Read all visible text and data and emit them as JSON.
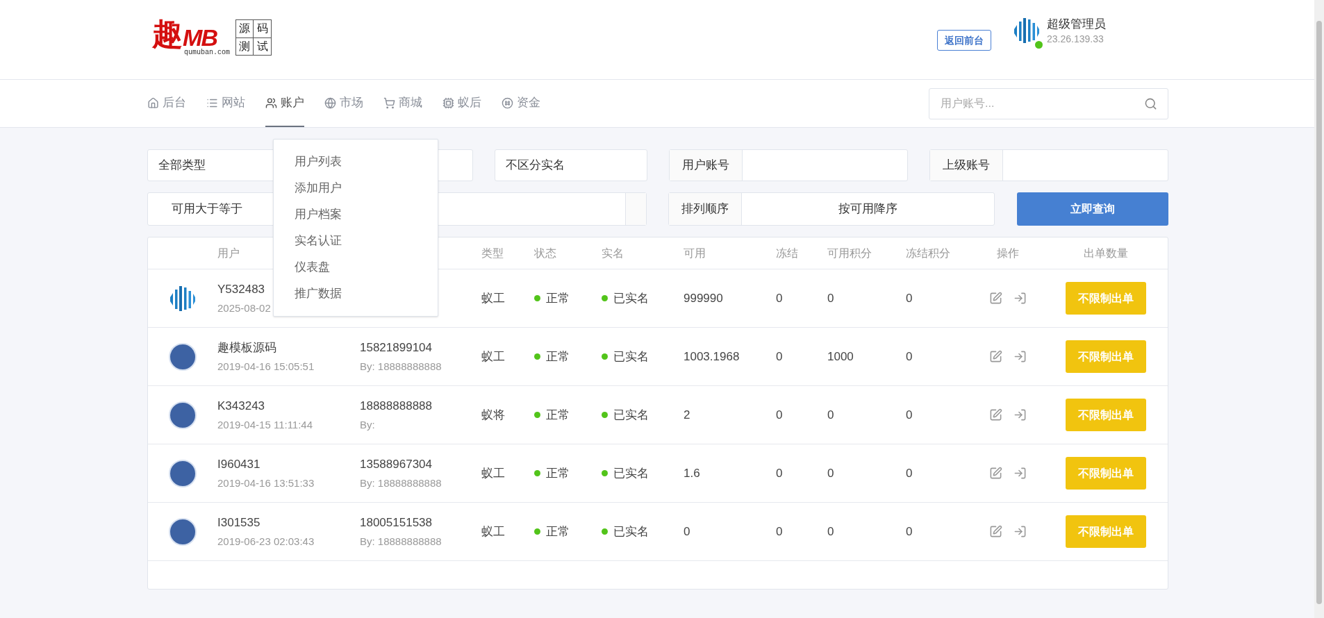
{
  "header": {
    "logo": {
      "mark": "趣",
      "letters": "MB",
      "domain": "qumuban.com",
      "tiles": [
        "源",
        "码",
        "测",
        "试"
      ]
    },
    "front_button": "返回前台",
    "admin": {
      "name": "超级管理员",
      "ip": "23.26.139.33",
      "online": true
    }
  },
  "nav": {
    "items": [
      {
        "label": "后台",
        "selected": false
      },
      {
        "label": "网站",
        "selected": false
      },
      {
        "label": "账户",
        "selected": true
      },
      {
        "label": "市场",
        "selected": false
      },
      {
        "label": "商城",
        "selected": false
      },
      {
        "label": "蚁后",
        "selected": false
      },
      {
        "label": "资金",
        "selected": false
      }
    ],
    "search": {
      "placeholder": "用户账号..."
    }
  },
  "menu": {
    "items": [
      "用户列表",
      "添加用户",
      "用户档案",
      "实名认证",
      "仪表盘",
      "推广数据"
    ]
  },
  "filters": {
    "type_select": "全部类型",
    "realname_select": "不区分实名",
    "account": {
      "label": "用户账号"
    },
    "parent_account": {
      "label": "上级账号"
    },
    "min_available": {
      "label": "可用大于等于"
    },
    "sort": {
      "label": "排列顺序",
      "value": "按可用降序"
    },
    "submit": "立即查询"
  },
  "table": {
    "columns": {
      "user": "用户",
      "type": "类型",
      "status": "状态",
      "realname": "实名",
      "available": "可用",
      "frozen": "冻结",
      "points": "可用积分",
      "frozen_points": "冻结积分",
      "actions": "操作",
      "orders": "出单数量"
    },
    "rows": [
      {
        "avatar_photo": false,
        "name": "Y532483",
        "date": "2025-08-02",
        "type": "蚁工",
        "status": "正常",
        "realname": "已实名",
        "available": "999990",
        "frozen": "0",
        "points": "0",
        "frozen_points": "0",
        "orders": "不限制出单"
      },
      {
        "avatar_photo": true,
        "name": "趣模板源码",
        "date": "2019-04-16 15:05:51",
        "account": "15821899104",
        "by": "By: 18888888888",
        "type": "蚁工",
        "status": "正常",
        "realname": "已实名",
        "available": "1003.1968",
        "frozen": "0",
        "points": "1000",
        "frozen_points": "0",
        "orders": "不限制出单"
      },
      {
        "avatar_photo": true,
        "name": "K343243",
        "date": "2019-04-15 11:11:44",
        "account": "18888888888",
        "by": "By:",
        "type": "蚁将",
        "status": "正常",
        "realname": "已实名",
        "available": "2",
        "frozen": "0",
        "points": "0",
        "frozen_points": "0",
        "orders": "不限制出单"
      },
      {
        "avatar_photo": true,
        "name": "I960431",
        "date": "2019-04-16 13:51:33",
        "account": "13588967304",
        "by": "By: 18888888888",
        "type": "蚁工",
        "status": "正常",
        "realname": "已实名",
        "available": "1.6",
        "frozen": "0",
        "points": "0",
        "frozen_points": "0",
        "orders": "不限制出单"
      },
      {
        "avatar_photo": true,
        "name": "I301535",
        "date": "2019-06-23 02:03:43",
        "account": "18005151538",
        "by": "By: 18888888888",
        "type": "蚁工",
        "status": "正常",
        "realname": "已实名",
        "available": "0",
        "frozen": "0",
        "points": "0",
        "frozen_points": "0",
        "orders": "不限制出单"
      }
    ]
  }
}
